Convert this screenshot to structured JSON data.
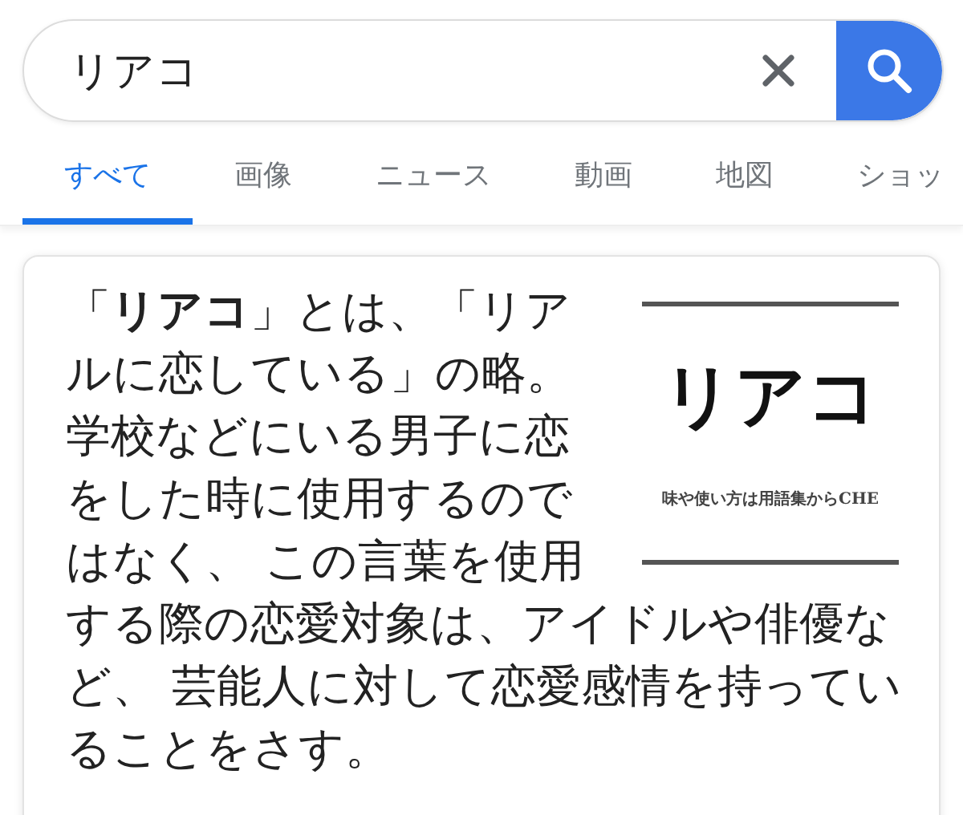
{
  "search": {
    "value": "リアコ"
  },
  "tabs": [
    {
      "label": "すべて",
      "selected": true
    },
    {
      "label": "画像",
      "selected": false
    },
    {
      "label": "ニュース",
      "selected": false
    },
    {
      "label": "動画",
      "selected": false
    },
    {
      "label": "地図",
      "selected": false
    },
    {
      "label": "ショッ",
      "selected": false
    }
  ],
  "result": {
    "text_beside_image": "「**リアコ**」とは、「リアルに恋している」の略。学校などにいる男子に恋をした時に使用するのではなく、 この言葉を使用",
    "text_below_image": "する際の恋愛対象は、アイドルや俳優など、 芸能人に対して恋愛感情を持っていることをさす。",
    "thumbnail": {
      "title": "リアコ",
      "subtitle": "味や使い方は用語集からCHE"
    }
  }
}
